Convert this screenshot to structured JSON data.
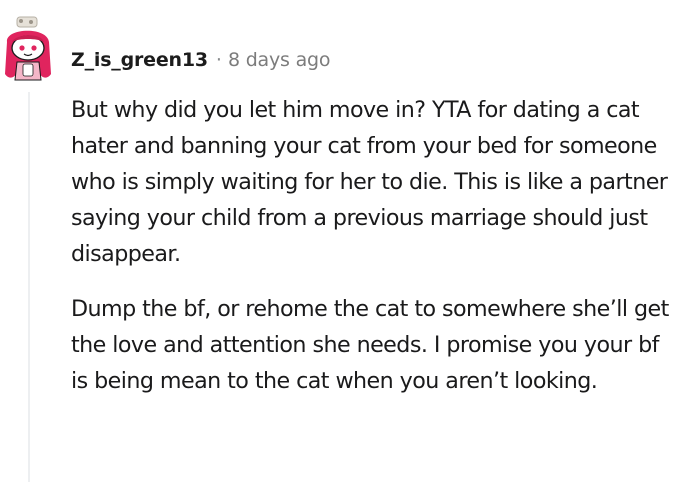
{
  "comment": {
    "author": "Z_is_green13",
    "separator": "·",
    "timestamp": "8 days ago",
    "avatar_icon": "snoo-avatar-icon",
    "paragraphs": [
      "But why did you let him move in? YTA for dating a cat hater and banning your cat from your bed for someone who is simply waiting for her to die. This is like a partner saying your child from a previous marriage should just disappear.",
      "Dump the bf, or rehome the cat to somewhere she’ll get the love and attention she needs. I promise you your bf is being mean to the cat when you aren’t looking."
    ]
  },
  "colors": {
    "thread_line": "#edeff1",
    "username": "#1c1c1c",
    "timestamp": "#7c7c7c",
    "text": "#1a1a1b",
    "avatar_hair": "#e0245e",
    "avatar_face": "#ffffff"
  }
}
